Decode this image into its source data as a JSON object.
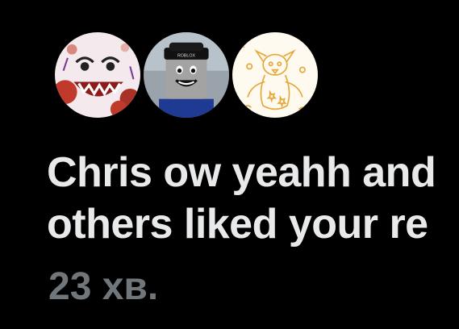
{
  "notification": {
    "avatars": [
      {
        "icon": "clown-drawing-avatar"
      },
      {
        "icon": "roblox-character-avatar"
      },
      {
        "icon": "bird-sketch-avatar"
      }
    ],
    "line1": "Chris ow yeahh and",
    "line2": "others liked your re",
    "timestamp": "23 хв."
  },
  "colors": {
    "background": "#000000",
    "text_primary": "#e7e9ea",
    "text_secondary": "#71767b"
  }
}
